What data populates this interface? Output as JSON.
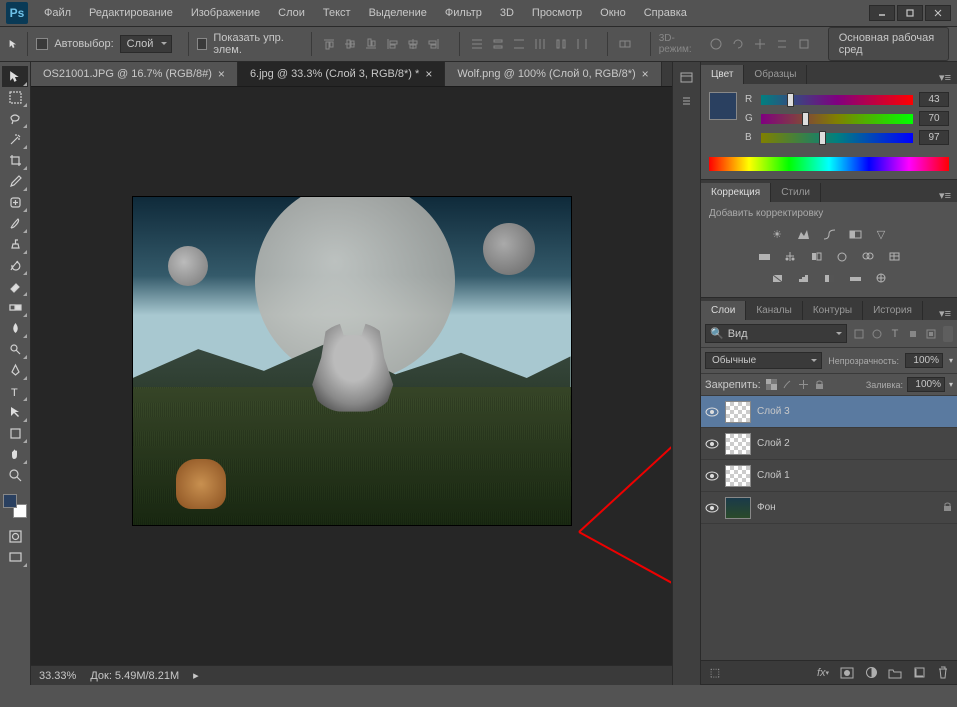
{
  "menubar": {
    "items": [
      "Файл",
      "Редактирование",
      "Изображение",
      "Слои",
      "Текст",
      "Выделение",
      "Фильтр",
      "3D",
      "Просмотр",
      "Окно",
      "Справка"
    ]
  },
  "options_bar": {
    "auto_select_label": "Автовыбор:",
    "auto_select_target": "Слой",
    "show_transform_label": "Показать упр. элем.",
    "mode_3d": "3D-режим:",
    "workspace": "Основная рабочая сред"
  },
  "doc_tabs": [
    {
      "label": "OS21001.JPG @ 16.7% (RGB/8#)",
      "active": false
    },
    {
      "label": "6.jpg @ 33.3% (Слой 3, RGB/8*) *",
      "active": true
    },
    {
      "label": "Wolf.png @ 100% (Слой 0, RGB/8*)",
      "active": false
    }
  ],
  "status": {
    "zoom": "33.33%",
    "doc": "Док: 5.49M/8.21M"
  },
  "color_panel": {
    "tabs": [
      "Цвет",
      "Образцы"
    ],
    "r": {
      "label": "R",
      "value": "43"
    },
    "g": {
      "label": "G",
      "value": "70"
    },
    "b": {
      "label": "B",
      "value": "97"
    }
  },
  "adjustments_panel": {
    "tabs": [
      "Коррекция",
      "Стили"
    ],
    "add_label": "Добавить корректировку"
  },
  "layers_panel": {
    "tabs": [
      "Слои",
      "Каналы",
      "Контуры",
      "История"
    ],
    "search_kind": "Вид",
    "blend_mode": "Обычные",
    "opacity_label": "Непрозрачность:",
    "opacity_value": "100%",
    "lock_label": "Закрепить:",
    "fill_label": "Заливка:",
    "fill_value": "100%",
    "layers": [
      {
        "name": "Слой 3",
        "selected": true,
        "thumb": "trans"
      },
      {
        "name": "Слой 2",
        "selected": false,
        "thumb": "trans"
      },
      {
        "name": "Слой 1",
        "selected": false,
        "thumb": "trans"
      },
      {
        "name": "Фон",
        "selected": false,
        "thumb": "bg",
        "locked": true
      }
    ]
  }
}
